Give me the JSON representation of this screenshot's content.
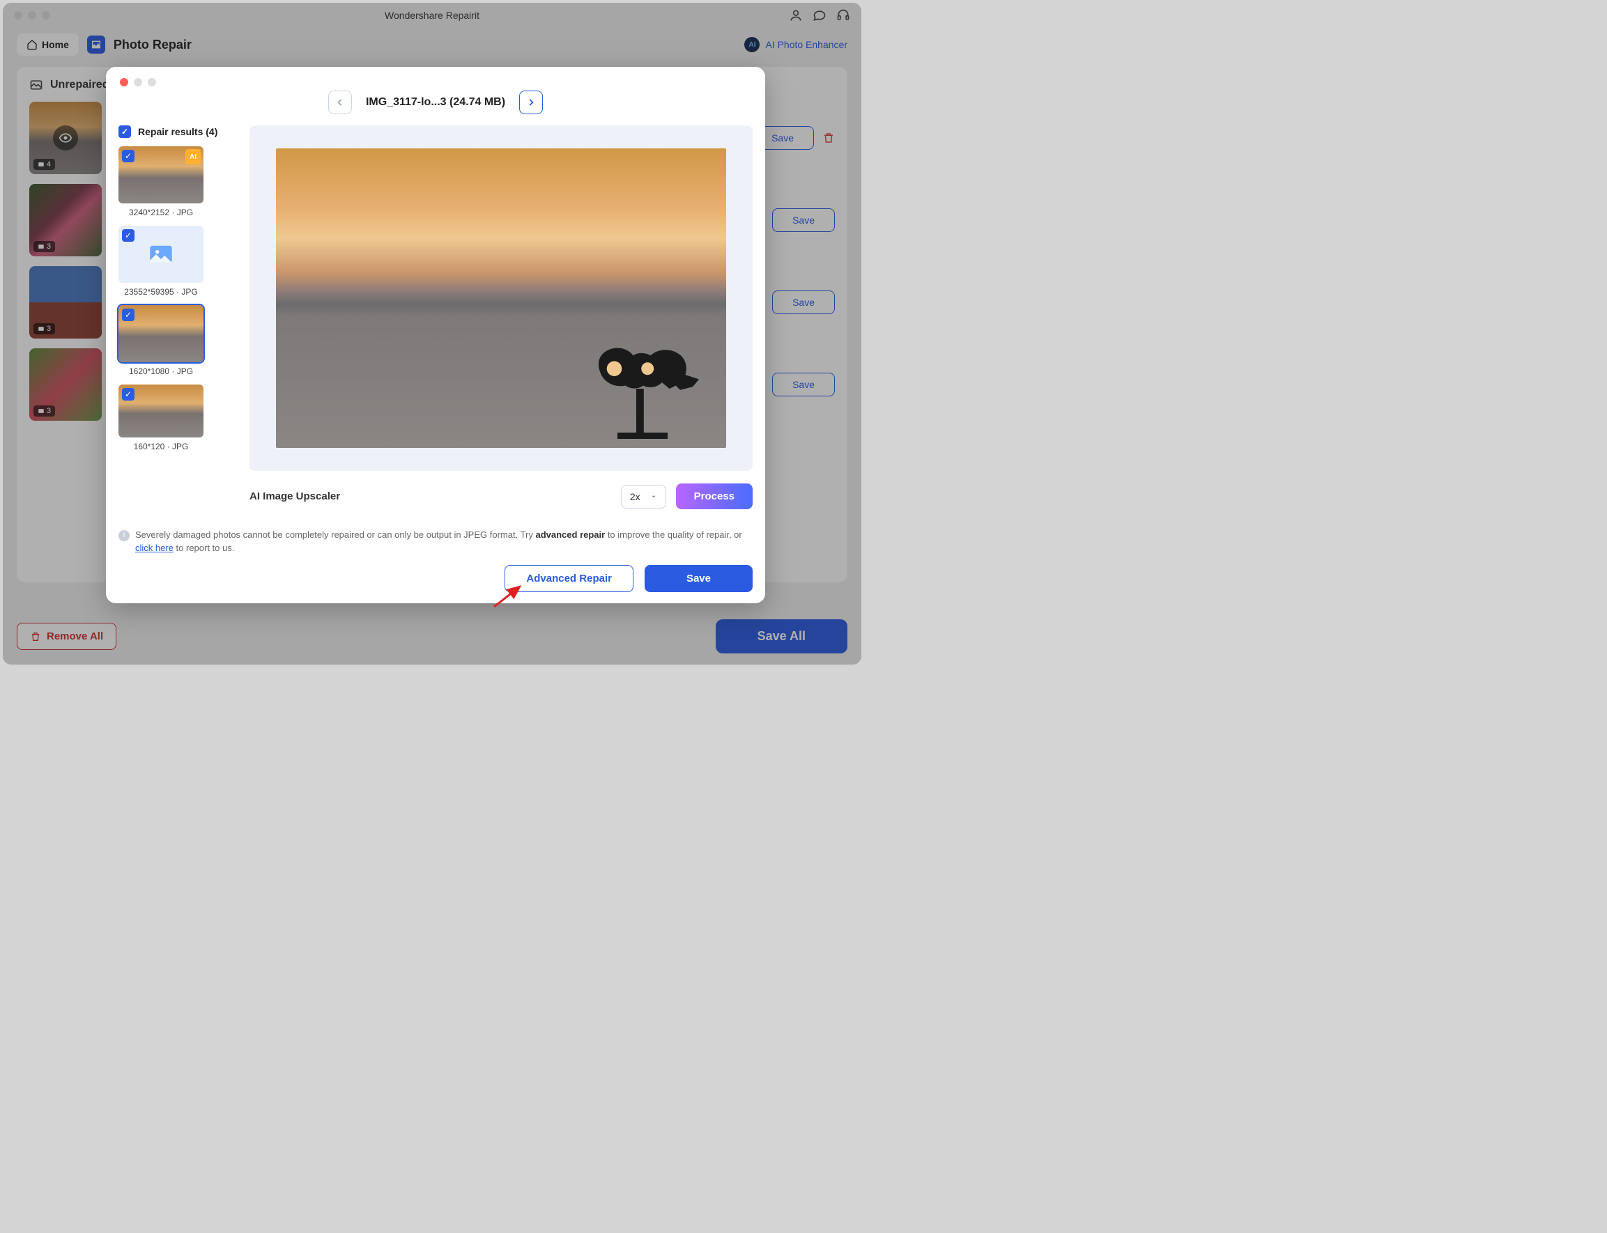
{
  "app_title": "Wondershare Repairit",
  "home_label": "Home",
  "feature_title": "Photo Repair",
  "ai_enhancer_label": "AI Photo Enhancer",
  "section_heading": "Unrepaired",
  "bg_items": [
    {
      "count": "4",
      "save": "Save"
    },
    {
      "count": "3",
      "save": "Save"
    },
    {
      "count": "3",
      "save": "Save"
    },
    {
      "count": "3",
      "save": "Save"
    }
  ],
  "remove_all": "Remove All",
  "save_all": "Save All",
  "modal": {
    "file": "IMG_3117-lo...3 (24.74 MB)",
    "results_head": "Repair results (4)",
    "results": [
      {
        "label": "3240*2152 · JPG",
        "ai": true
      },
      {
        "label": "23552*59395 · JPG",
        "placeholder": true
      },
      {
        "label": "1620*1080 · JPG",
        "selected": true
      },
      {
        "label": "160*120 · JPG"
      }
    ],
    "upscaler_title": "AI Image Upscaler",
    "upscaler_value": "2x",
    "process": "Process",
    "info_pre": "Severely damaged photos cannot be completely repaired or can only be output in JPEG format. Try ",
    "info_bold": "advanced repair",
    "info_mid": " to improve the quality of repair, or ",
    "info_link": "click here",
    "info_post": " to report to us.",
    "advanced": "Advanced Repair",
    "save": "Save"
  }
}
